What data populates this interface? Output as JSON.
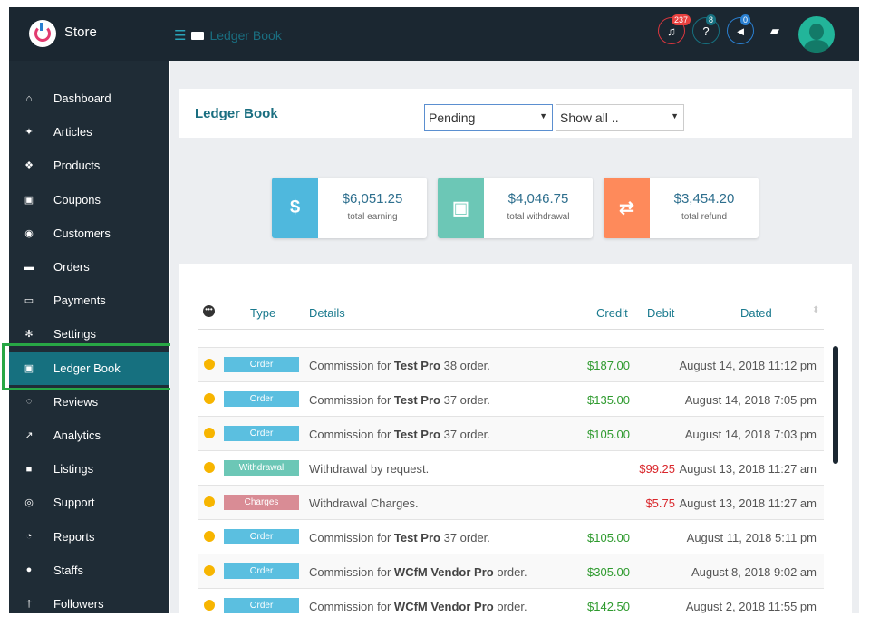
{
  "header": {
    "store": "Store",
    "breadcrumb": "Ledger Book",
    "notifications": "237",
    "help_count": "8",
    "announcements": "0"
  },
  "sidebar": {
    "items": [
      {
        "label": "Dashboard",
        "icon": "home-icon",
        "glyph": "⌂"
      },
      {
        "label": "Articles",
        "icon": "articles-icon",
        "glyph": "✦"
      },
      {
        "label": "Products",
        "icon": "products-icon",
        "glyph": "❖"
      },
      {
        "label": "Coupons",
        "icon": "gift-icon",
        "glyph": "▣"
      },
      {
        "label": "Customers",
        "icon": "user-circle-icon",
        "glyph": "◉"
      },
      {
        "label": "Orders",
        "icon": "cart-icon",
        "glyph": "▬"
      },
      {
        "label": "Payments",
        "icon": "credit-card-icon",
        "glyph": "▭"
      },
      {
        "label": "Settings",
        "icon": "gears-icon",
        "glyph": "✻"
      },
      {
        "label": "Ledger Book",
        "icon": "money-icon",
        "glyph": "▣"
      },
      {
        "label": "Reviews",
        "icon": "comments-icon",
        "glyph": "◌"
      },
      {
        "label": "Analytics",
        "icon": "line-chart-icon",
        "glyph": "↗"
      },
      {
        "label": "Listings",
        "icon": "briefcase-icon",
        "glyph": "■"
      },
      {
        "label": "Support",
        "icon": "life-ring-icon",
        "glyph": "◎"
      },
      {
        "label": "Reports",
        "icon": "pie-chart-icon",
        "glyph": "◔"
      },
      {
        "label": "Staffs",
        "icon": "user-icon",
        "glyph": "●"
      },
      {
        "label": "Followers",
        "icon": "child-icon",
        "glyph": "†"
      }
    ]
  },
  "page": {
    "title": "Ledger Book",
    "status_filter": "Pending",
    "type_filter": "Show all .."
  },
  "stats": [
    {
      "value": "$6,051.25",
      "label": "total earning",
      "glyph": "$",
      "color": "#4fb8dd"
    },
    {
      "value": "$4,046.75",
      "label": "total withdrawal",
      "glyph": "▣",
      "color": "#6cc7b6"
    },
    {
      "value": "$3,454.20",
      "label": "total refund",
      "glyph": "⇄",
      "color": "#fe8a5b"
    }
  ],
  "table": {
    "headers": {
      "type": "Type",
      "details": "Details",
      "credit": "Credit",
      "debit": "Debit",
      "dated": "Dated"
    },
    "rows": [
      {
        "type": "Order",
        "color": "#5bbfe0",
        "pre": "Commission for ",
        "bold": "Test Pro",
        "post": " 38 order.",
        "credit": "$187.00",
        "debit": "",
        "date": "August 14, 2018 11:12 pm"
      },
      {
        "type": "Order",
        "color": "#5bbfe0",
        "pre": "Commission for ",
        "bold": "Test Pro",
        "post": " 37 order.",
        "credit": "$135.00",
        "debit": "",
        "date": "August 14, 2018 7:05 pm"
      },
      {
        "type": "Order",
        "color": "#5bbfe0",
        "pre": "Commission for ",
        "bold": "Test Pro",
        "post": " 37 order.",
        "credit": "$105.00",
        "debit": "",
        "date": "August 14, 2018 7:03 pm"
      },
      {
        "type": "Withdrawal",
        "color": "#6cc7b6",
        "pre": "Withdrawal by request.",
        "bold": "",
        "post": "",
        "credit": "",
        "debit": "$99.25",
        "date": "August 13, 2018 11:27 am"
      },
      {
        "type": "Charges",
        "color": "#d98c95",
        "pre": "Withdrawal Charges.",
        "bold": "",
        "post": "",
        "credit": "",
        "debit": "$5.75",
        "date": "August 13, 2018 11:27 am"
      },
      {
        "type": "Order",
        "color": "#5bbfe0",
        "pre": "Commission for ",
        "bold": "Test Pro",
        "post": " 37 order.",
        "credit": "$105.00",
        "debit": "",
        "date": "August 11, 2018 5:11 pm"
      },
      {
        "type": "Order",
        "color": "#5bbfe0",
        "pre": "Commission for ",
        "bold": "WCfM Vendor Pro",
        "post": " order.",
        "credit": "$305.00",
        "debit": "",
        "date": "August 8, 2018 9:02 am"
      },
      {
        "type": "Order",
        "color": "#5bbfe0",
        "pre": "Commission for ",
        "bold": "WCfM Vendor Pro",
        "post": " order.",
        "credit": "$142.50",
        "debit": "",
        "date": "August 2, 2018 11:55 pm"
      }
    ]
  }
}
